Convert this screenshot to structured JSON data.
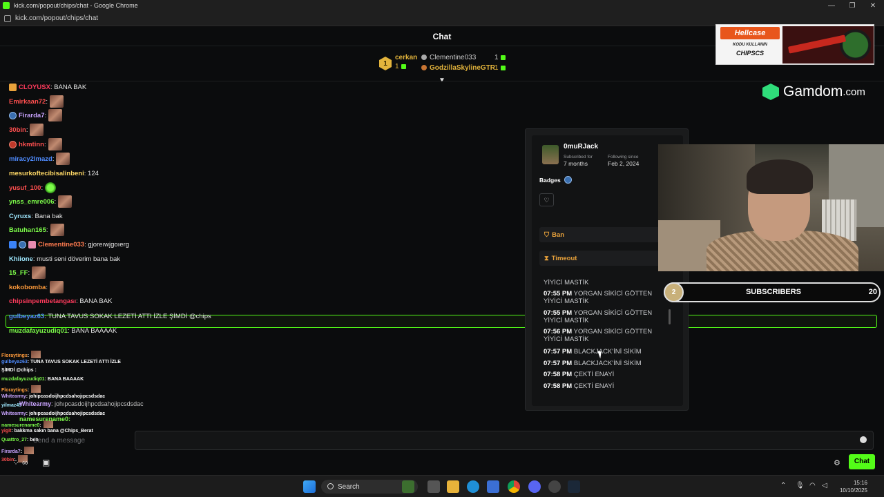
{
  "browser": {
    "window_title": "kick.com/popout/chips/chat - Google Chrome",
    "url": "kick.com/popout/chips/chat"
  },
  "chat": {
    "title": "Chat",
    "top_gifters": [
      {
        "rank": "1",
        "name": "cerkan",
        "count": "1"
      },
      {
        "name": "Clementine033",
        "count": "1"
      },
      {
        "name": "GodzillaSkylineGTR",
        "count": "1"
      }
    ],
    "messages": [
      {
        "user": "CLOYUSX",
        "color": "#ff3b5c",
        "text": ": BANA BAK",
        "badge": "pop"
      },
      {
        "user": "Emirkaan72",
        "color": "#ff4f4f",
        "text": ":",
        "emote": true
      },
      {
        "user": "Firarda7",
        "color": "#c9a4ff",
        "text": ":",
        "emote": true,
        "badge": "circle"
      },
      {
        "user": "30bin",
        "color": "#ff4f4f",
        "text": ":",
        "emote": true
      },
      {
        "user": "hkmtinn",
        "color": "#ff4f4f",
        "text": ":",
        "emote": true,
        "badge": "red"
      },
      {
        "user": "miracy2lmazd",
        "color": "#4f8cff",
        "text": ":",
        "emote": true
      },
      {
        "user": "mesurkoftecibisalinbeni",
        "color": "#ffd966",
        "text": ": 124"
      },
      {
        "user": "yusuf_100",
        "color": "#ff4f4f",
        "text": ":",
        "emote": "green"
      },
      {
        "user": "ynss_emre006",
        "color": "#7dfc4a",
        "text": ":",
        "emote": true
      },
      {
        "user": "Cyruxs",
        "color": "#9fe8ff",
        "text": ": Bana bak"
      },
      {
        "user": "Batuhan165",
        "color": "#7dfc4a",
        "text": ":",
        "emote": true
      },
      {
        "user": "Clementine033",
        "color": "#ff7b4f",
        "text": ": gjoreıwjgoıerg",
        "badge": "multi"
      },
      {
        "user": "Khiione",
        "color": "#9fe8ff",
        "text": ": musti seni döverim bana bak"
      },
      {
        "user": "15_FF",
        "color": "#7dfc4a",
        "text": ":",
        "emote": true
      },
      {
        "user": "kokobomba",
        "color": "#ff9b3b",
        "text": ":",
        "emote": true
      },
      {
        "user": "chipsinpembetangası",
        "color": "#ff3b5c",
        "text": ": BANA BAK"
      },
      {
        "user": "gulbeyaz63",
        "color": "#4f8cff",
        "text": ": TUNA TAVUS SOKAK LEZETİ ATTI İZLE ŞİMDİ @chips"
      },
      {
        "user": "muzdafayuzudiq01",
        "color": "#7dfc4a",
        "text": ": BANA BAAAAK"
      }
    ],
    "input_placeholder": "Send a message",
    "send_label": "Chat"
  },
  "overlay_chat": [
    {
      "user": "Floraytings",
      "text": ":"
    },
    {
      "user": "gulbeyaz63",
      "text": ": TUNA TAVUS SOKAK LEZETİ ATTI İZLE"
    },
    {
      "user": "",
      "text": "ŞİMDİ @chips :"
    },
    {
      "user": "muzdafayuzudiq01",
      "text": ": BANA BAAAAK"
    },
    {
      "user": "Floraytings",
      "text": ":"
    },
    {
      "user": "Whitearmy",
      "text": ": johipcasdoijhpcdsahojıpcsdsdac"
    },
    {
      "user": "yilmaz45",
      "text": ""
    },
    {
      "user": "Whitearmy",
      "text": ": johıpcasdoijhpcdsahojipcsdsdac"
    },
    {
      "user": "namesurename0",
      "text": ":"
    },
    {
      "user": "yigit",
      "text": ": bakkma sakın bana @Chips_Berat"
    },
    {
      "user": "Quattro_27",
      "text": ": ben"
    },
    {
      "user": "Firarda7",
      "text": ":"
    },
    {
      "user": "30bin",
      "text": ":"
    }
  ],
  "overlay_partial": {
    "whitearmy_text": "johıpcasdoijhpcdsahojipcsdsdac",
    "namesurename": "namesurename0"
  },
  "user_card": {
    "username": "0muRJack",
    "subscribed_label": "Subscribed for",
    "subscribed_value": "7 months",
    "following_label": "Following since",
    "following_value": "Feb 2, 2024",
    "badges_label": "Badges",
    "ban_label": "Ban",
    "timeout_label": "Timeout",
    "history": [
      {
        "time": "",
        "text": "YİYİCİ MASTİK"
      },
      {
        "time": "07:55 PM",
        "text": "YORGAN SİKİCİ GÖTTEN YİYİCİ MASTİK"
      },
      {
        "time": "07:55 PM",
        "text": "YORGAN SİKİCİ GÖTTEN YİYİCİ MASTİK"
      },
      {
        "time": "07:56 PM",
        "text": "YORGAN SİKİCİ GÖTTEN YİYİCİ MASTİK"
      },
      {
        "time": "07:57 PM",
        "text": "BLACKJACK'İNİ SİKİM"
      },
      {
        "time": "07:57 PM",
        "text": "BLACKJACK'İNİ SİKİM"
      },
      {
        "time": "07:58 PM",
        "text": "ÇEKTİ ENAYİ"
      },
      {
        "time": "07:58 PM",
        "text": "ÇEKTİ ENAYİ"
      }
    ]
  },
  "stream_overlay": {
    "hellcase_logo": "Hellcase",
    "hellcase_sub": "KODU KULLANIN",
    "hellcase_code": "CHIPSCS",
    "gamdom": "Gamdom",
    "gamdom_tld": ".com",
    "subscribers_label": "SUBSCRIBERS",
    "subscribers_badge": "2",
    "subscribers_count": "20"
  },
  "taskbar": {
    "search_label": "Search",
    "time": "15:16",
    "date": "10/10/2025"
  }
}
